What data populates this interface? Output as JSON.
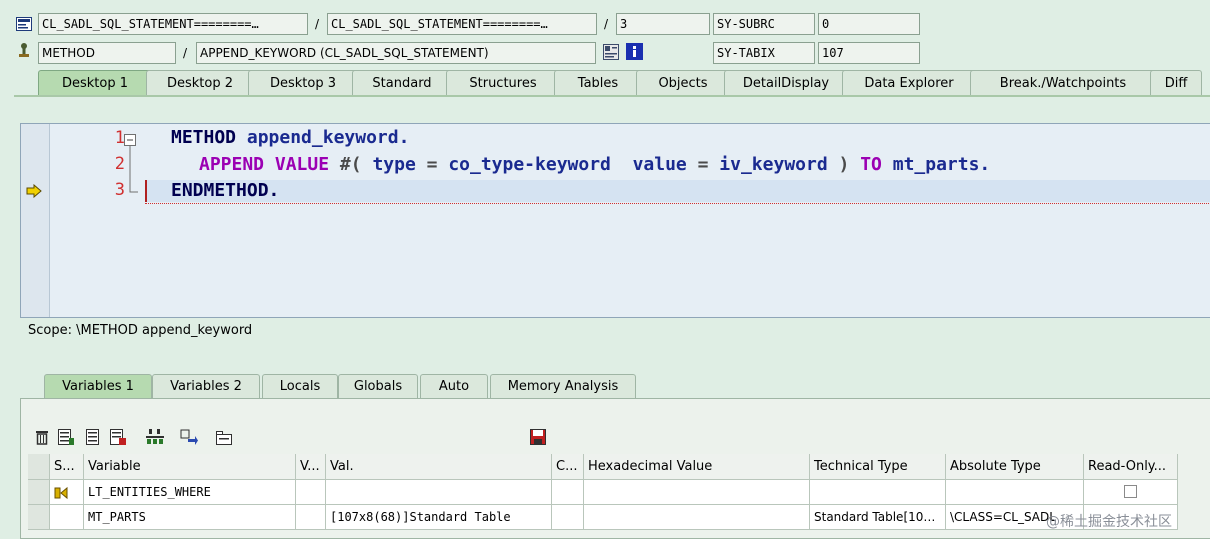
{
  "header": {
    "program1": "CL_SADL_SQL_STATEMENT========…",
    "program2": "CL_SADL_SQL_STATEMENT========…",
    "line": "3",
    "subrc_label": "SY-SUBRC",
    "subrc_value": "0",
    "type": "METHOD",
    "event": "APPEND_KEYWORD (CL_SADL_SQL_STATEMENT)",
    "tabix_label": "SY-TABIX",
    "tabix_value": "107",
    "slash": "/"
  },
  "tabs": [
    "Desktop 1",
    "Desktop 2",
    "Desktop 3",
    "Standard",
    "Structures",
    "Tables",
    "Objects",
    "DetailDisplay",
    "Data Explorer",
    "Break./Watchpoints",
    "Diff"
  ],
  "editor": {
    "lines": [
      {
        "number": "1",
        "parts": [
          "METHOD",
          "append_keyword."
        ]
      },
      {
        "number": "2",
        "parts": [
          "APPEND",
          "VALUE",
          "#(",
          "type",
          "=",
          "co_type-keyword",
          "value",
          "=",
          "iv_keyword",
          ")",
          "TO",
          "mt_parts."
        ]
      },
      {
        "number": "3",
        "parts": [
          "ENDMETHOD."
        ]
      }
    ]
  },
  "scope": "Scope: \\METHOD append_keyword",
  "var_tabs": [
    "Variables 1",
    "Variables 2",
    "Locals",
    "Globals",
    "Auto",
    "Memory Analysis"
  ],
  "grid": {
    "headers": [
      "S...",
      "Variable",
      "V...",
      "Val.",
      "C...",
      "Hexadecimal Value",
      "Technical Type",
      "Absolute Type",
      "Read-Only..."
    ],
    "rows": [
      {
        "variable": "LT_ENTITIES_WHERE",
        "value": "",
        "technical": "",
        "absolute": ""
      },
      {
        "variable": "MT_PARTS",
        "value": "[107x8(68)]Standard Table",
        "technical": "Standard Table[10…",
        "absolute": "\\CLASS=CL_SADL"
      }
    ]
  },
  "watermark": "@稀土掘金技术社区",
  "colors": {
    "tab_active": "#b6dab0",
    "keyword": "#000050",
    "keyword_purple": "#9b00b3",
    "identifier": "#1a2a90",
    "line_number": "#d03030"
  }
}
